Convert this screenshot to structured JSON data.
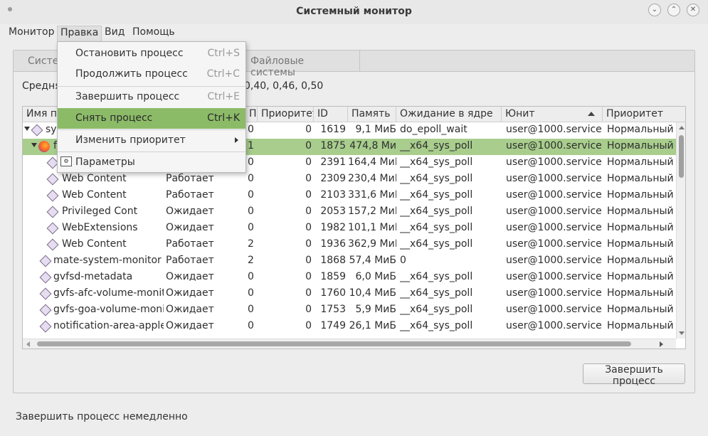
{
  "window": {
    "title": "Системный монитор"
  },
  "menubar": {
    "items": [
      "Монитор",
      "Правка",
      "Вид",
      "Помощь"
    ]
  },
  "tabs": [
    "Систе",
    "Файловые системы"
  ],
  "load_average": {
    "text": "Средня",
    "values": "0,40, 0,46, 0,50"
  },
  "table": {
    "headers": [
      "Имя пр",
      "П",
      "Приоритет",
      "ID",
      "Память",
      "Ожидание в ядре",
      "Юнит",
      "Приоритет"
    ],
    "rows": [
      {
        "name": "sy",
        "status": "",
        "cpu": "0",
        "nice": "0",
        "id": "1619",
        "mem": "9,1 МиБ",
        "wait": "do_epoll_wait",
        "unit": "user@1000.service",
        "prio": "Нормальный"
      },
      {
        "name": "f",
        "status": "",
        "cpu": "1",
        "nice": "0",
        "id": "1875",
        "mem": "474,8 Ми",
        "wait": "__x64_sys_poll",
        "unit": "user@1000.service",
        "prio": "Нормальный"
      },
      {
        "name": "",
        "status": "",
        "cpu": "0",
        "nice": "0",
        "id": "2391",
        "mem": "164,4 МиБ",
        "wait": "__x64_sys_poll",
        "unit": "user@1000.service",
        "prio": "Нормальный"
      },
      {
        "name": "Web Content",
        "status": "Работает",
        "cpu": "0",
        "nice": "0",
        "id": "2309",
        "mem": "230,4 МиБ",
        "wait": "__x64_sys_poll",
        "unit": "user@1000.service",
        "prio": "Нормальный"
      },
      {
        "name": "Web Content",
        "status": "Работает",
        "cpu": "0",
        "nice": "0",
        "id": "2103",
        "mem": "331,6 МиБ",
        "wait": "__x64_sys_poll",
        "unit": "user@1000.service",
        "prio": "Нормальный"
      },
      {
        "name": "Privileged Cont",
        "status": "Ожидает",
        "cpu": "0",
        "nice": "0",
        "id": "2053",
        "mem": "157,2 МиБ",
        "wait": "__x64_sys_poll",
        "unit": "user@1000.service",
        "prio": "Нормальный"
      },
      {
        "name": "WebExtensions",
        "status": "Ожидает",
        "cpu": "0",
        "nice": "0",
        "id": "1982",
        "mem": "101,1 МиБ",
        "wait": "__x64_sys_poll",
        "unit": "user@1000.service",
        "prio": "Нормальный"
      },
      {
        "name": "Web Content",
        "status": "Работает",
        "cpu": "2",
        "nice": "0",
        "id": "1936",
        "mem": "362,9 МиБ",
        "wait": "__x64_sys_poll",
        "unit": "user@1000.service",
        "prio": "Нормальный"
      },
      {
        "name": "mate-system-monitor",
        "status": "Работает",
        "cpu": "2",
        "nice": "0",
        "id": "1868",
        "mem": "57,4 МиБ",
        "wait": "0",
        "unit": "user@1000.service",
        "prio": "Нормальный"
      },
      {
        "name": "gvfsd-metadata",
        "status": "Ожидает",
        "cpu": "0",
        "nice": "0",
        "id": "1859",
        "mem": "6,0 МиБ",
        "wait": "__x64_sys_poll",
        "unit": "user@1000.service",
        "prio": "Нормальный"
      },
      {
        "name": "gvfs-afc-volume-monit",
        "status": "Ожидает",
        "cpu": "0",
        "nice": "0",
        "id": "1760",
        "mem": "10,4 МиБ",
        "wait": "__x64_sys_poll",
        "unit": "user@1000.service",
        "prio": "Нормальный"
      },
      {
        "name": "gvfs-goa-volume-moni",
        "status": "Ожидает",
        "cpu": "0",
        "nice": "0",
        "id": "1753",
        "mem": "5,9 МиБ",
        "wait": "__x64_sys_poll",
        "unit": "user@1000.service",
        "prio": "Нормальный"
      },
      {
        "name": "notification-area-apple",
        "status": "Ожидает",
        "cpu": "0",
        "nice": "0",
        "id": "1749",
        "mem": "26,1 МиБ",
        "wait": "__x64_sys_poll",
        "unit": "user@1000.service",
        "prio": "Нормальный"
      }
    ]
  },
  "edit_menu": {
    "items": [
      {
        "label": "Остановить процесс",
        "accel": "Ctrl+S"
      },
      {
        "label": "Продолжить процесс",
        "accel": "Ctrl+C"
      },
      {
        "label": "Завершить процесс",
        "accel": "Ctrl+E"
      },
      {
        "label": "Снять процесс",
        "accel": "Ctrl+K"
      },
      {
        "label": "Изменить приоритет",
        "accel": ""
      },
      {
        "label": "Параметры",
        "accel": ""
      }
    ]
  },
  "actions": {
    "end_process": "Завершить процесс"
  },
  "status": {
    "text": "Завершить процесс немедленно"
  },
  "colors": {
    "selection": "#a8cd8d",
    "menu_highlight": "#8cbb68"
  }
}
